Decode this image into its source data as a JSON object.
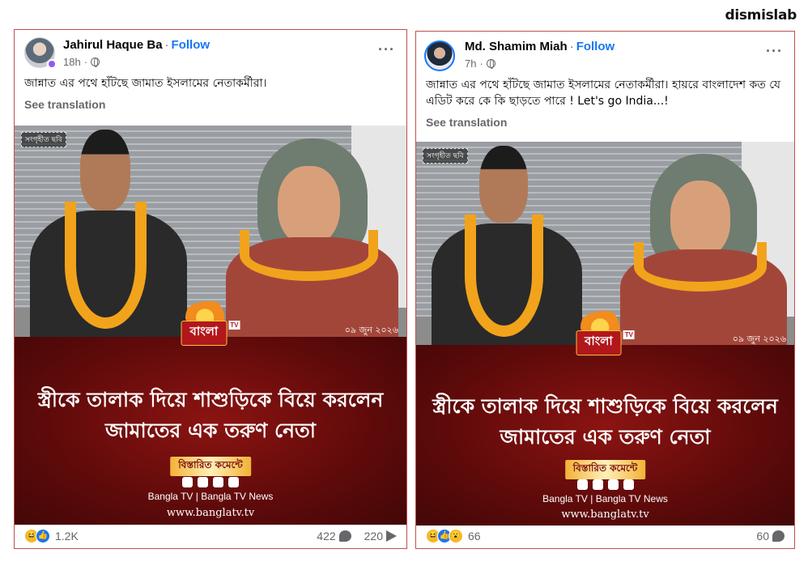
{
  "brand": "dismislab",
  "posts": [
    {
      "author": "Jahirul Haque Ba",
      "follow_label": "Follow",
      "time": "18h",
      "caption": "জান্নাত এর পথে হাঁটছে জামাত ইসলামের নেতাকর্মীরা।",
      "see_translation": "See translation",
      "image": {
        "tag": "সংগৃহীত ছবি",
        "date": "০৯ জুন ২০২৬",
        "logo_word": "বাংলা",
        "logo_tv": "TV",
        "headline_line1": "স্ত্রীকে তালাক দিয়ে শাশুড়িকে বিয়ে করলেন",
        "headline_line2": "জামাতের এক তরুণ নেতা",
        "details_label": "বিস্তারিত কমেন্টে",
        "channel": "Bangla TV | Bangla TV News",
        "website": "www.banglatv.tv"
      },
      "reactions_count": "1.2K",
      "comments_count": "422",
      "shares_count": "220",
      "reaction_icons": [
        "haha-icon",
        "like-icon"
      ]
    },
    {
      "author": "Md. Shamim Miah",
      "follow_label": "Follow",
      "time": "7h",
      "caption": "জান্নাত এর পথে হাঁটছে জামাত ইসলামের নেতাকর্মীরা। হায়রে বাংলাদেশ কত যে এডিট করে কে কি ছাড়তে পারে ! Let's go India...!",
      "see_translation": "See translation",
      "image": {
        "tag": "সংগৃহীত ছবি",
        "date": "০৯ জুন ২০২৬",
        "logo_word": "বাংলা",
        "logo_tv": "TV",
        "headline_line1": "স্ত্রীকে তালাক দিয়ে শাশুড়িকে বিয়ে করলেন",
        "headline_line2": "জামাতের এক তরুণ নেতা",
        "details_label": "বিস্তারিত কমেন্টে",
        "channel": "Bangla TV | Bangla TV News",
        "website": "www.banglatv.tv"
      },
      "reactions_count": "66",
      "comments_count": "60",
      "reaction_icons": [
        "haha-icon",
        "like-icon",
        "wow-icon"
      ]
    }
  ],
  "colors": {
    "follow": "#1877f2",
    "border": "#c0504d",
    "panel": "#5e0a0a"
  }
}
